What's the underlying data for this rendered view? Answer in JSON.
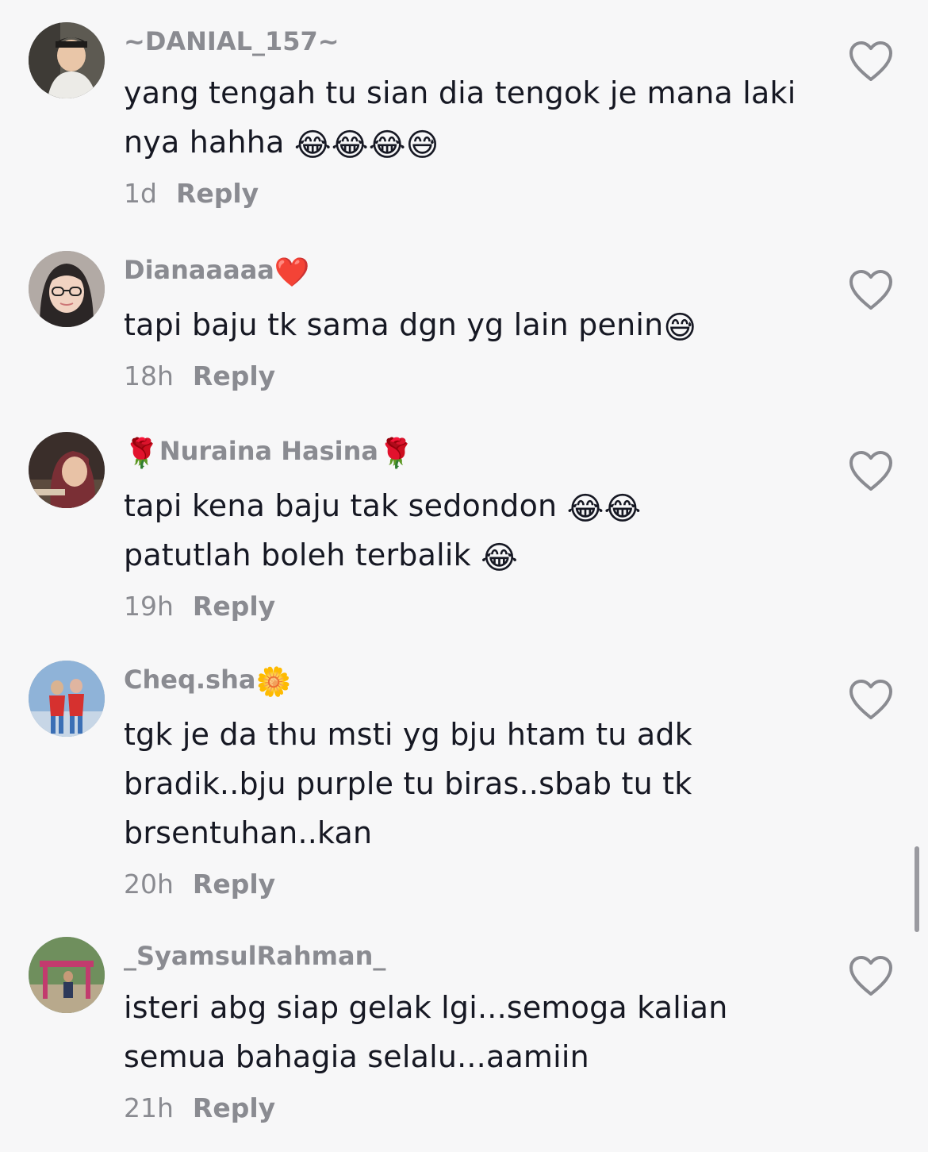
{
  "comments": [
    {
      "username": "~DANIAL_157~",
      "text": "yang tengah tu sian dia tengok je mana laki nya hahha",
      "emojis": "😂😂😂😅",
      "time": "1d",
      "reply": "Reply"
    },
    {
      "username": "Dianaaaaa",
      "username_suffix": "❤️",
      "text": "tapi baju tk sama dgn yg lain penin",
      "emojis": "😅",
      "time": "18h",
      "reply": "Reply"
    },
    {
      "username_prefix": "🌹",
      "username": "Nuraina Hasina",
      "username_suffix": "🌹",
      "text_line1": "tapi kena baju tak sedondon",
      "emojis_line1": "😂😂",
      "text_line2": "patutlah boleh terbalik",
      "emojis_line2": "😂",
      "time": "19h",
      "reply": "Reply"
    },
    {
      "username": "Cheq.sha",
      "username_suffix": "🌼",
      "text": "tgk je da thu msti yg bju htam tu adk bradik..bju purple tu biras..sbab tu tk brsentuhan..kan",
      "time": "20h",
      "reply": "Reply"
    },
    {
      "username": "_SyamsulRahman_",
      "text": "isteri abg siap gelak lgi...semoga kalian semua bahagia selalu...aamiin",
      "time": "21h",
      "reply": "Reply"
    }
  ],
  "icons": {
    "like": "heart-outline-icon"
  },
  "colors": {
    "username": "#8a8b91",
    "text": "#161823",
    "background": "#f7f7f8"
  }
}
